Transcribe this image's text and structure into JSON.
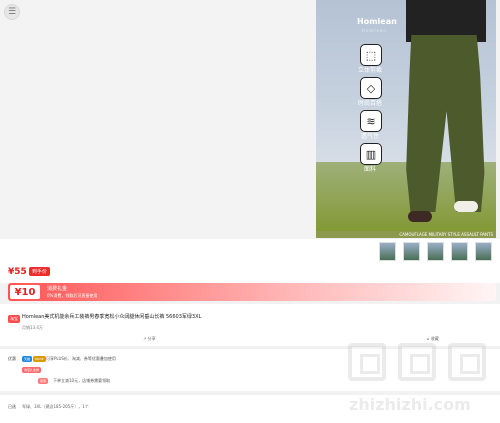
{
  "top": {
    "menu_icon": "hamburger-icon"
  },
  "hero": {
    "brand": "Homlean",
    "brand_sub": "Homlean",
    "features": [
      {
        "icon": "box-icon",
        "label": "立体剪裁"
      },
      {
        "icon": "gem-icon",
        "label": "时尚百搭"
      },
      {
        "icon": "wind-icon",
        "label": "透气性"
      },
      {
        "icon": "fabric-icon",
        "label": "面料"
      }
    ],
    "caption": "CAMOUFLAGE MILITARY STYLE ASSAULT PANTS"
  },
  "pricing": {
    "price": "¥55",
    "price_tag": "到手价"
  },
  "coupon": {
    "amount": "¥10",
    "title": "消费礼金",
    "subtitle": "0%消费，领取后可直接使用"
  },
  "product": {
    "badge": "淘宝",
    "title": "Homlean美式机能余兵工装裤男春季宽松小众阔腿休闲垂山长裤 56603军绿3XL",
    "sales": "月销13.4万",
    "share": "分享",
    "collect": "收藏"
  },
  "promotion": {
    "label": "优惠",
    "chip1": "天猫",
    "chip2": "88VIP",
    "text1": "可享PLUS价、淘减、券等优惠叠加使用",
    "chip3": "淘宝礼金券",
    "chip4": "使用",
    "text2": "下单立减10元，店铺券需要领取"
  },
  "spec": {
    "label": "已选",
    "text": "军绿、3XL（建议185-205斤），1个"
  },
  "watermark": {
    "text": "zhizhizhi.com"
  }
}
